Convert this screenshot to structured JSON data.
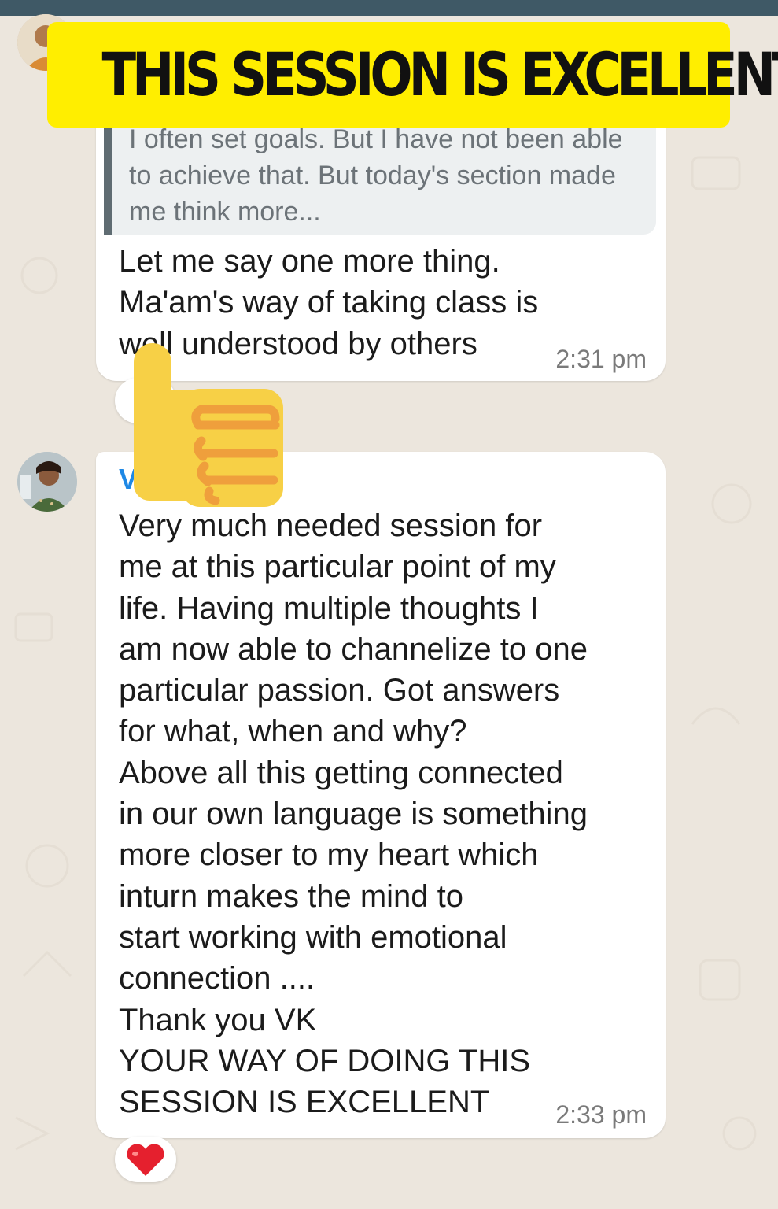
{
  "banner": {
    "text": "THIS SESSION IS EXCELLENT"
  },
  "messages": [
    {
      "quoted_text": "I often set goals.  But I have not been able to achieve that.  But today's section made me think more...",
      "text": "Let me say one more thing.\nMa'am's way of taking class is well understood by others",
      "time": "2:31 pm",
      "reaction": "thumbs-up"
    },
    {
      "sender": "V",
      "text": "Very much needed session for\nme at this particular point of my\nlife. Having multiple thoughts I\nam now able to channelize to one\nparticular passion. Got answers\nfor what, when and why?\nAbove all this getting connected\nin our own language is something\nmore closer to my heart which\ninturn makes the mind to\nstart working with emotional\nconnection ....\nThank you VK\nYOUR WAY OF DOING THIS\nSESSION IS EXCELLENT",
      "time": "2:33 pm",
      "reaction": "heart"
    }
  ],
  "colors": {
    "banner": "#ffee00",
    "background": "#ece6dd",
    "top_bar": "#3f5966",
    "sender_name": "#1e88e5"
  },
  "icons": {
    "overlay_sticker": "thumbs-up-icon",
    "reaction_2": "red-heart-icon"
  }
}
